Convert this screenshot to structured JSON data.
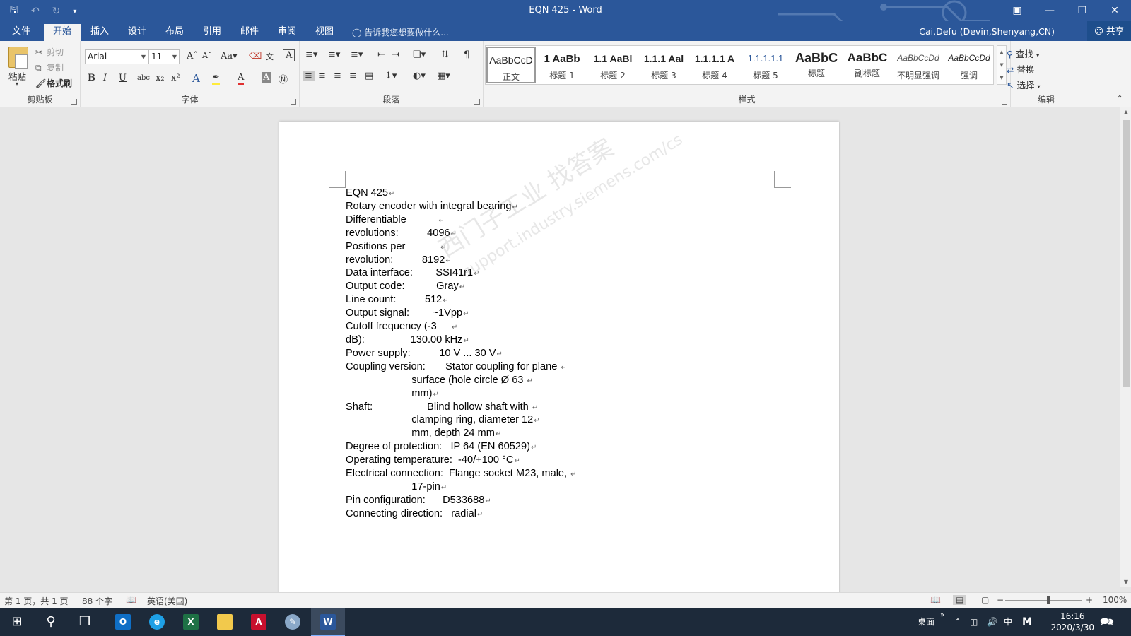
{
  "window": {
    "title": "EQN 425 - Word"
  },
  "tabs": [
    {
      "label": "文件"
    },
    {
      "label": "开始"
    },
    {
      "label": "插入"
    },
    {
      "label": "设计"
    },
    {
      "label": "布局"
    },
    {
      "label": "引用"
    },
    {
      "label": "邮件"
    },
    {
      "label": "审阅"
    },
    {
      "label": "视图"
    }
  ],
  "tellme": "告诉我您想要做什么...",
  "user": "Cai,Defu (Devin,Shenyang,CN)",
  "share": "共享",
  "clipboard": {
    "paste": "粘贴",
    "cut": "剪切",
    "copy": "复制",
    "format_painter": "格式刷",
    "group": "剪贴板"
  },
  "font": {
    "name": "Arial",
    "size": "11",
    "group": "字体",
    "change_case": "Aa"
  },
  "paragraph": {
    "group": "段落"
  },
  "styles": {
    "group": "样式",
    "items": [
      {
        "preview": "AaBbCcD",
        "name": "正文"
      },
      {
        "preview": "1 AaBb",
        "name": "标题 1"
      },
      {
        "preview": "1.1 AaBl",
        "name": "标题 2"
      },
      {
        "preview": "1.1.1 Aal",
        "name": "标题 3"
      },
      {
        "preview": "1.1.1.1 A",
        "name": "标题 4"
      },
      {
        "preview": "1.1.1.1.1",
        "name": "标题 5"
      },
      {
        "preview": "AaBbC",
        "name": "标题"
      },
      {
        "preview": "AaBbC",
        "name": "副标题"
      },
      {
        "preview": "AaBbCcDd",
        "name": "不明显强调"
      },
      {
        "preview": "AaBbCcDd",
        "name": "强调"
      }
    ]
  },
  "editing": {
    "find": "查找",
    "replace": "替换",
    "select": "选择",
    "group": "编辑"
  },
  "document": {
    "lines": [
      "EQN 425",
      "Rotary encoder with integral bearing",
      "Differentiable           ",
      "revolutions:          4096",
      "Positions per            ",
      "revolution:          8192",
      "Data interface:        SSI41r1",
      "Output code:           Gray",
      "Line count:          512",
      "Output signal:        ~1Vpp",
      "Cutoff frequency (-3     ",
      "dB):                130.00 kHz",
      "Power supply:          10 V ... 30 V",
      "Coupling version:       Stator coupling for plane ",
      "                       surface (hole circle Ø 63 ",
      "                       mm)",
      "Shaft:                   Blind hollow shaft with ",
      "                       clamping ring, diameter 12",
      "                       mm, depth 24 mm",
      "Degree of protection:   IP 64 (EN 60529)",
      "Operating temperature:  -40/+100 °C",
      "Electrical connection:  Flange socket M23, male, ",
      "                       17-pin",
      "Pin configuration:      D533688",
      "Connecting direction:   radial"
    ],
    "watermark": "西门子工业  找答案",
    "watermark_url": "support.industry.siemens.com/cs"
  },
  "status": {
    "page": "第 1 页，共 1 页",
    "words": "88 个字",
    "language": "英语(美国)",
    "zoom": "100%"
  },
  "taskbar": {
    "desktop": "桌面",
    "ime": "中",
    "time": "16:16",
    "date": "2020/3/30"
  }
}
